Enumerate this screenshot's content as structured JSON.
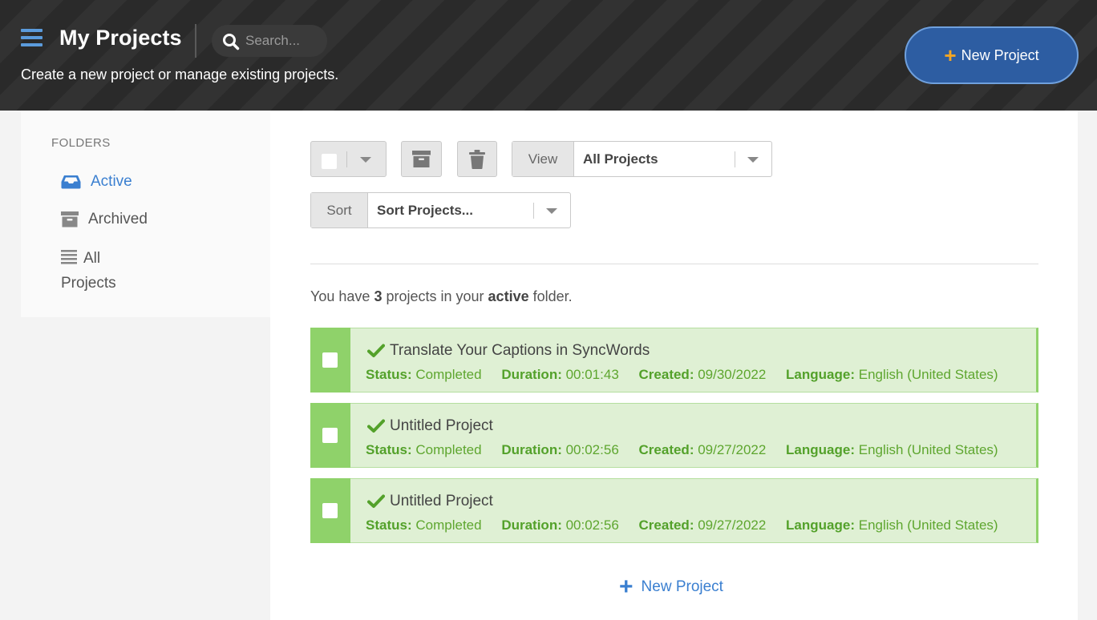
{
  "header": {
    "title": "My Projects",
    "subtitle": "Create a new project or manage existing projects.",
    "search_placeholder": "Search...",
    "new_project_label": "New Project"
  },
  "sidebar": {
    "heading": "FOLDERS",
    "items": [
      {
        "label": "Active",
        "icon": "inbox-icon",
        "active": true
      },
      {
        "label": "Archived",
        "icon": "archive-box-icon",
        "active": false
      },
      {
        "label": "All Projects",
        "label_line1": "All",
        "label_line2": "Projects",
        "icon": "list-icon",
        "active": false
      }
    ]
  },
  "toolbar": {
    "view_label": "View",
    "view_value": "All Projects",
    "sort_label": "Sort",
    "sort_value": "Sort Projects..."
  },
  "summary": {
    "prefix": "You have",
    "count": "3",
    "middle": "projects in your",
    "folder": "active",
    "suffix": "folder."
  },
  "field_labels": {
    "status": "Status:",
    "duration": "Duration:",
    "created": "Created:",
    "language": "Language:"
  },
  "projects": [
    {
      "name": "Translate Your Captions in SyncWords",
      "status": "Completed",
      "duration": "00:01:43",
      "created": "09/30/2022",
      "language": "English (United States)"
    },
    {
      "name": "Untitled Project",
      "status": "Completed",
      "duration": "00:02:56",
      "created": "09/27/2022",
      "language": "English (United States)"
    },
    {
      "name": "Untitled Project",
      "status": "Completed",
      "duration": "00:02:56",
      "created": "09/27/2022",
      "language": "English (United States)"
    }
  ],
  "bottom_new_project_label": "New Project",
  "colors": {
    "accent_blue": "#3a7fd0",
    "header_button": "#2d5da2",
    "plus_orange": "#f5a623",
    "completed_green": "#8fd26a",
    "row_bg": "#dff0d4"
  }
}
